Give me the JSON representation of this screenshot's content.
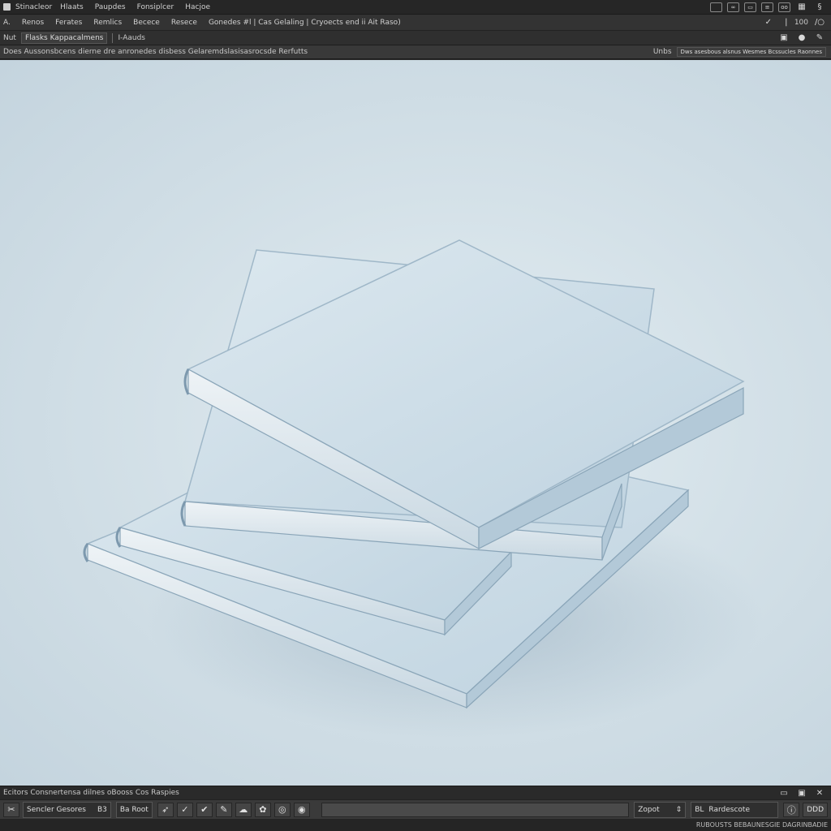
{
  "menu": {
    "items": [
      "Stinacleor",
      "Hlaats",
      "Paupdes",
      "Fonsiplcer",
      "Hacjoe"
    ]
  },
  "toolbar": {
    "tool_glyph": "A.",
    "items": [
      "Renos",
      "Ferates",
      "Remlics",
      "Becece",
      "Resece"
    ],
    "context_label": "Gonedes #l | Cas Gelaling | Cryoects end ii  Ait Raso)",
    "zoom_value": "100"
  },
  "options": {
    "label": "Nut",
    "field": "Flasks Kappacalmens",
    "extra": "I-Aauds"
  },
  "info": {
    "text": "Does Aussonsbcens dierne dre anronedes disbess Gelaremdslasisasrocsde Rerfutts",
    "right_label": "Unbs",
    "search_value": "Dws asesbous alsnus Wesmes Bcssucles Raonnes"
  },
  "status": {
    "text": "Ecitors  Consnertensa dilnes  oBooss Cos Raspies"
  },
  "bottom": {
    "group1_label": "Sencler Gesores",
    "group1_suffix": "B3",
    "group2_label": "Ba Root",
    "progress_fraction": 0,
    "zoom_label": "Zopot",
    "name_prefix": "BL",
    "name_value": "Rardescote",
    "end_button": "DDD"
  },
  "footer": {
    "text": "RUBOUSTS  BEBAUNESGIE DAGRINBADIE"
  },
  "icons": {
    "menubar_right": [
      "square-outline-icon",
      "eye-link-icon",
      "layout-icon",
      "layers-icon",
      "glasses-icon",
      "grid-icon",
      "settings-s-icon"
    ],
    "bottom_tools": [
      "scissors-icon",
      "brush-icon",
      "check-icon",
      "check-alt-icon",
      "pen-icon",
      "blob-icon",
      "splat-icon",
      "circle-icon",
      "target-icon"
    ]
  },
  "colors": {
    "background_panel": "#2b2b2b",
    "canvas": "#d4e1e8",
    "book_cover": "#c9dbe6",
    "book_edge": "#8faac0"
  }
}
